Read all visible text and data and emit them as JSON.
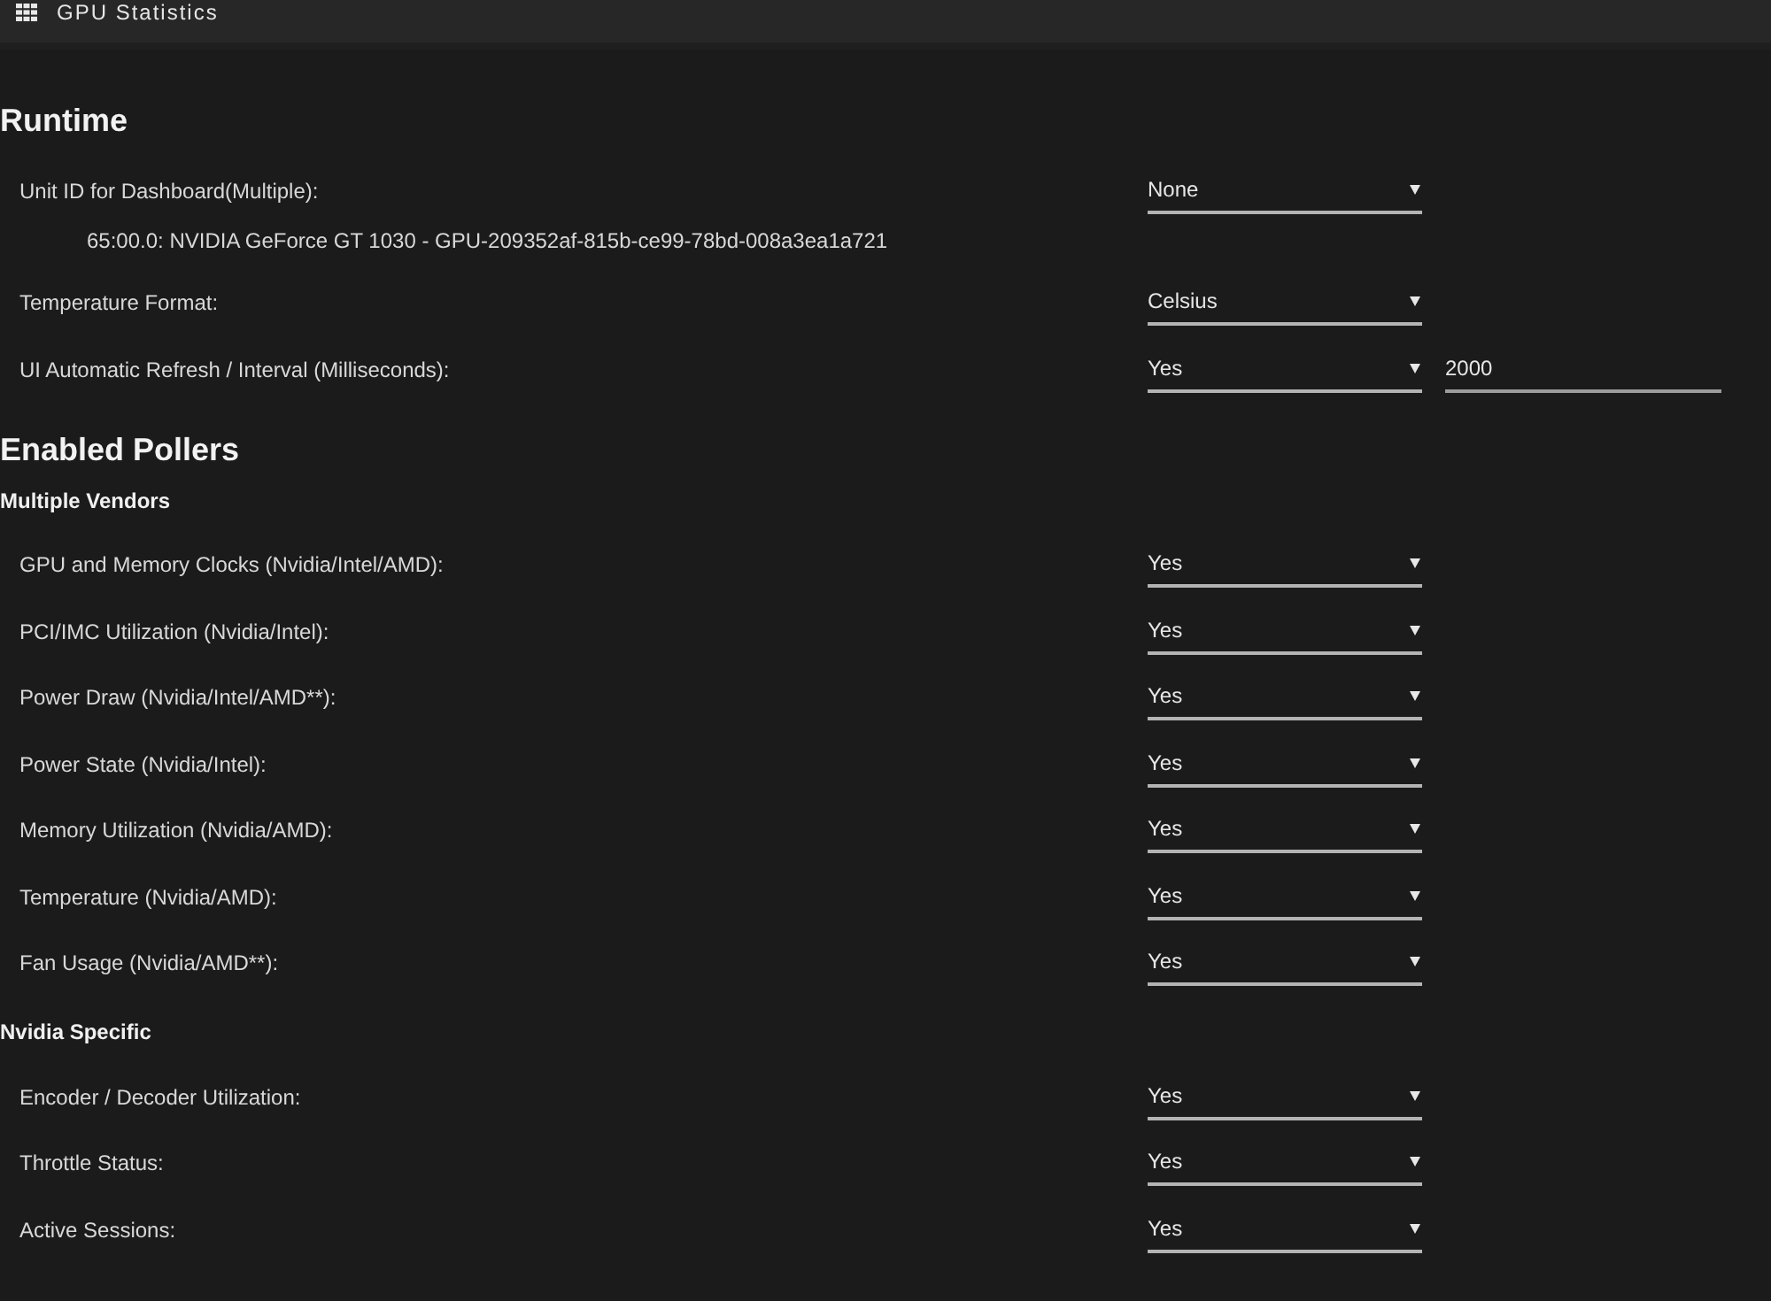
{
  "header": {
    "title": "GPU Statistics"
  },
  "sections": [
    {
      "title": "Runtime",
      "groups": [
        {
          "rows": [
            {
              "label": "Unit ID for Dashboard(Multiple):",
              "value": "None",
              "detail": "65:00.0: NVIDIA GeForce GT 1030 - GPU-209352af-815b-ce99-78bd-008a3ea1a721"
            },
            {
              "label": "Temperature Format:",
              "value": "Celsius"
            },
            {
              "label": "UI Automatic Refresh / Interval (Milliseconds):",
              "value": "Yes",
              "input": "2000"
            }
          ]
        }
      ]
    },
    {
      "title": "Enabled Pollers",
      "groups": [
        {
          "title": "Multiple Vendors",
          "rows": [
            {
              "label": "GPU and Memory Clocks (Nvidia/Intel/AMD):",
              "value": "Yes"
            },
            {
              "label": "PCI/IMC Utilization (Nvidia/Intel):",
              "value": "Yes"
            },
            {
              "label": "Power Draw (Nvidia/Intel/AMD**):",
              "value": "Yes"
            },
            {
              "label": "Power State (Nvidia/Intel):",
              "value": "Yes"
            },
            {
              "label": "Memory Utilization (Nvidia/AMD):",
              "value": "Yes"
            },
            {
              "label": "Temperature (Nvidia/AMD):",
              "value": "Yes"
            },
            {
              "label": "Fan Usage (Nvidia/AMD**):",
              "value": "Yes"
            }
          ]
        },
        {
          "title": "Nvidia Specific",
          "rows": [
            {
              "label": "Encoder / Decoder Utilization:",
              "value": "Yes"
            },
            {
              "label": "Throttle Status:",
              "value": "Yes"
            },
            {
              "label": "Active Sessions:",
              "value": "Yes"
            }
          ]
        }
      ]
    }
  ]
}
